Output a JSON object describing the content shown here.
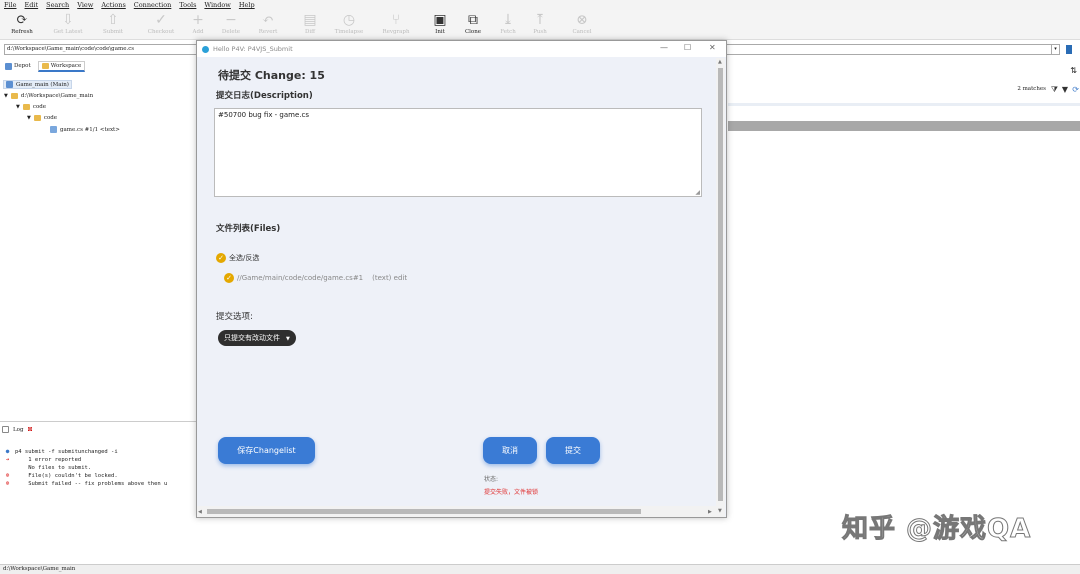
{
  "menu": [
    "File",
    "Edit",
    "Search",
    "View",
    "Actions",
    "Connection",
    "Tools",
    "Window",
    "Help"
  ],
  "toolbar": [
    {
      "label": "Refresh",
      "icon": "⟳",
      "enabled": true
    },
    {
      "label": "Get Latest",
      "icon": "⇩",
      "enabled": false
    },
    {
      "label": "Submit",
      "icon": "⇧",
      "enabled": false
    },
    {
      "label": "Checkout",
      "icon": "✓",
      "enabled": false
    },
    {
      "label": "Add",
      "icon": "+",
      "enabled": false
    },
    {
      "label": "Delete",
      "icon": "−",
      "enabled": false
    },
    {
      "label": "Revert",
      "icon": "↶",
      "enabled": false
    },
    {
      "label": "Diff",
      "icon": "▤",
      "enabled": false
    },
    {
      "label": "Timelapse",
      "icon": "◷",
      "enabled": false
    },
    {
      "label": "Revgraph",
      "icon": "⑂",
      "enabled": false
    },
    {
      "label": "Init",
      "icon": "▣",
      "enabled": true
    },
    {
      "label": "Clone",
      "icon": "⧉",
      "enabled": true
    },
    {
      "label": "Fetch",
      "icon": "⤓",
      "enabled": false
    },
    {
      "label": "Push",
      "icon": "⤒",
      "enabled": false
    },
    {
      "label": "Cancel",
      "icon": "⊗",
      "enabled": false
    }
  ],
  "path": "d:\\Workspace\\Game_main\\code\\code\\game.cs",
  "tabs": {
    "depot": "Depot",
    "workspace": "Workspace"
  },
  "tree": {
    "root": "Game_main (Main)",
    "ws": "d:\\Workspace\\Game_main",
    "f1": "code",
    "f2": "code",
    "file": "game.cs #1/1 <text>"
  },
  "right": {
    "matches": "2 matches"
  },
  "log": {
    "tab": "Log",
    "lines": [
      {
        "icon": "info",
        "text": "p4 submit -f submitunchanged -i"
      },
      {
        "icon": "arrow",
        "text": "    1 error reported"
      },
      {
        "icon": "none",
        "text": "    No files to submit."
      },
      {
        "icon": "err",
        "text": "    File(s) couldn't be locked."
      },
      {
        "icon": "err",
        "text": "    Submit failed -- fix problems above then u"
      }
    ]
  },
  "status": "d:\\Workspace\\Game_main",
  "dialog": {
    "window_title": "Hello P4V: P4VJS_Submit",
    "title": "待提交 Change: 15",
    "desc_label": "提交日志(Description)",
    "desc_value": "#50700 bug fix - game.cs",
    "files_label": "文件列表(Files)",
    "select_all": "全选/反选",
    "file_path": "//Game/main/code/code/game.cs#1",
    "file_meta": "(text) edit",
    "options_label": "提交选项:",
    "option_value": "只提交有改动文件",
    "btn_save": "保存Changelist",
    "btn_cancel": "取消",
    "btn_submit": "提交",
    "status_label": "状态:",
    "status_value": "提交失败，文件被锁",
    "status_color": "#e03030",
    "accent": "#3a7bd5"
  },
  "watermark": "知乎 @游戏QA"
}
